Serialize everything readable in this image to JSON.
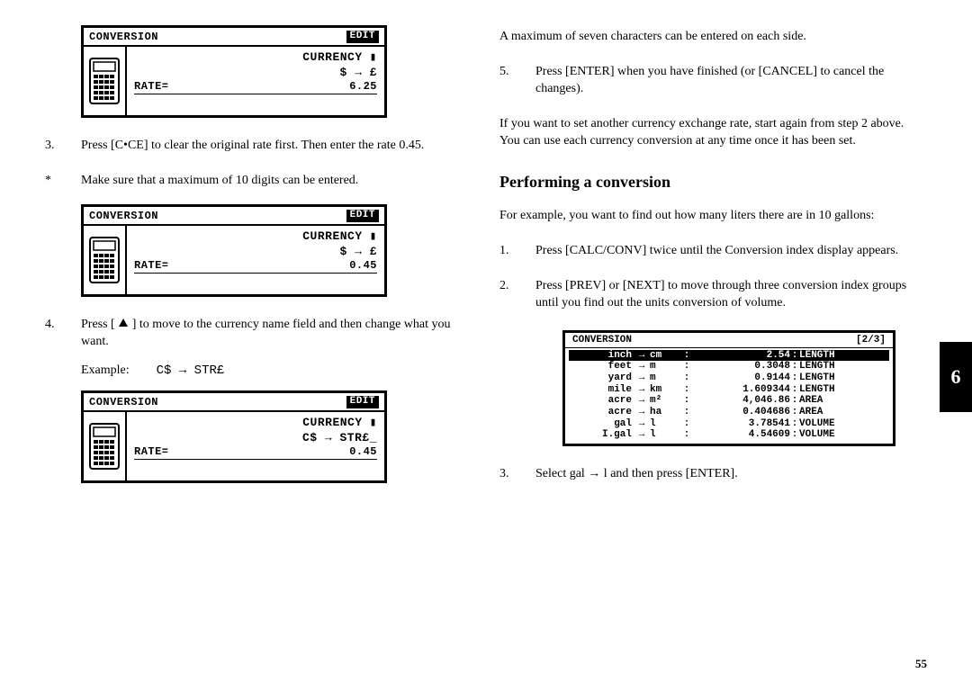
{
  "section_number": "6",
  "page_number": "55",
  "left": {
    "lcd1": {
      "title": "CONVERSION",
      "mode": "EDIT",
      "currency_label": "CURRENCY",
      "symbols": "$ → £",
      "rate_label": "RATE=",
      "rate_value": "6.25"
    },
    "step3": {
      "num": "3.",
      "text": "Press [C•CE] to clear the original rate first. Then enter the rate 0.45."
    },
    "note": {
      "num": "*",
      "text": "Make sure that a maximum of 10 digits can be entered."
    },
    "lcd2": {
      "title": "CONVERSION",
      "mode": "EDIT",
      "currency_label": "CURRENCY",
      "symbols": "$ → £",
      "rate_label": "RATE=",
      "rate_value": "0.45"
    },
    "step4": {
      "num": "4.",
      "text_before": "Press [ ",
      "text_after": " ] to move to the currency name field and then change what you want."
    },
    "example_label": "Example:",
    "example_value": "C$  →  STR£",
    "lcd3": {
      "title": "CONVERSION",
      "mode": "EDIT",
      "currency_label": "CURRENCY",
      "symbols": "C$ → STR£_",
      "rate_label": "RATE=",
      "rate_value": "0.45"
    }
  },
  "right": {
    "p1": "A maximum of seven characters can be entered on each side.",
    "step5": {
      "num": "5.",
      "text": "Press [ENTER] when you have finished (or [CANCEL] to cancel the changes)."
    },
    "p2": "If you want to set another currency exchange rate, start again from step 2 above. You can use each currency conversion at any time once it has been set.",
    "heading": "Performing a conversion",
    "p3": "For example, you want to find out how many liters there are in 10 gallons:",
    "r_step1": {
      "num": "1.",
      "text": "Press [CALC/CONV] twice until the Conversion index display appears."
    },
    "r_step2": {
      "num": "2.",
      "text": "Press [PREV] or [NEXT] to move through three conversion index groups until you find out the units conversion of volume."
    },
    "conv_table": {
      "title": "CONVERSION",
      "page": "[2/3]",
      "rows": [
        {
          "from": "inch",
          "to": "cm",
          "factor": "2.54",
          "cat": "LENGTH",
          "selected": true
        },
        {
          "from": "feet",
          "to": "m",
          "factor": "0.3048",
          "cat": "LENGTH",
          "selected": false
        },
        {
          "from": "yard",
          "to": "m",
          "factor": "0.9144",
          "cat": "LENGTH",
          "selected": false
        },
        {
          "from": "mile",
          "to": "km",
          "factor": "1.609344",
          "cat": "LENGTH",
          "selected": false
        },
        {
          "from": "acre",
          "to": "m²",
          "factor": "4,046.86",
          "cat": "AREA",
          "selected": false
        },
        {
          "from": "acre",
          "to": "ha",
          "factor": "0.404686",
          "cat": "AREA",
          "selected": false
        },
        {
          "from": "gal",
          "to": "l",
          "factor": "3.78541",
          "cat": "VOLUME",
          "selected": false
        },
        {
          "from": "I.gal",
          "to": "l",
          "factor": "4.54609",
          "cat": "VOLUME",
          "selected": false
        }
      ]
    },
    "r_step3": {
      "num": "3.",
      "text": "Select gal → l and then press [ENTER]."
    }
  }
}
